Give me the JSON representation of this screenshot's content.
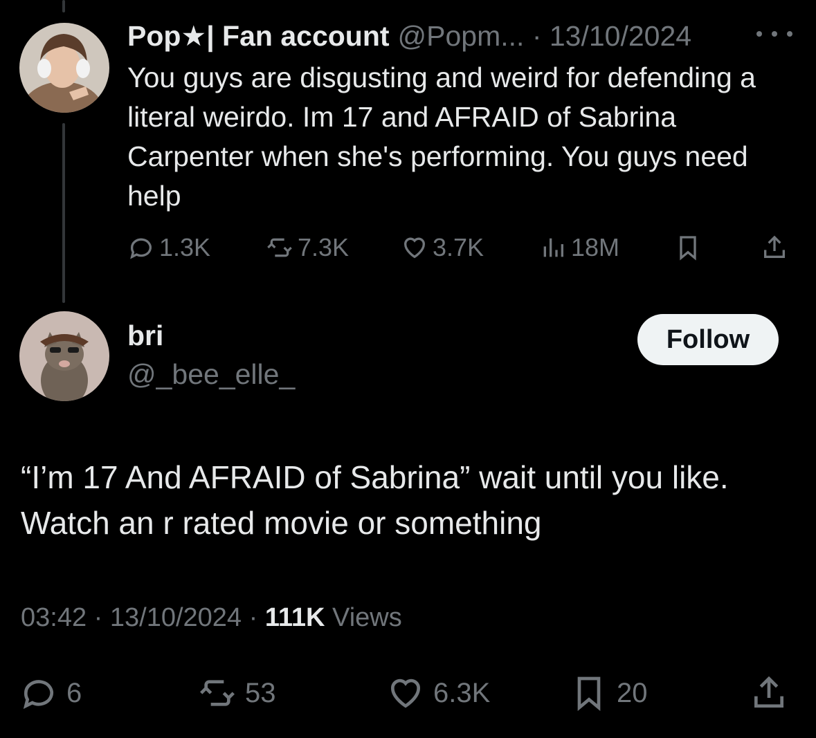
{
  "parent_tweet": {
    "display_name": "Pop★| Fan account",
    "handle_and_date": "@Popm... · 13/10/2024",
    "text": "You guys are disgusting and weird for defending a literal weirdo. Im 17 and AFRAID of Sabrina Carpenter when she's performing. You guys need help",
    "stats": {
      "replies": "1.3K",
      "reposts": "7.3K",
      "likes": "3.7K",
      "views": "18M"
    }
  },
  "reply_tweet": {
    "display_name": "bri",
    "handle": "@_bee_elle_",
    "follow_label": "Follow",
    "text": "“I’m 17 And AFRAID of Sabrina” wait until you like. Watch an r rated movie or something",
    "time_date": "03:42 · 13/10/2024 · ",
    "views_count": "111K",
    "views_label": " Views",
    "stats": {
      "replies": "6",
      "reposts": "53",
      "likes": "6.3K",
      "bookmarks": "20"
    }
  },
  "colors": {
    "background": "#000000",
    "text": "#e7e9ea",
    "dim": "#71767b",
    "follow_bg": "#eff3f4"
  },
  "icons": [
    "reply-icon",
    "repost-icon",
    "like-icon",
    "views-icon",
    "bookmark-icon",
    "share-icon",
    "more-icon"
  ]
}
